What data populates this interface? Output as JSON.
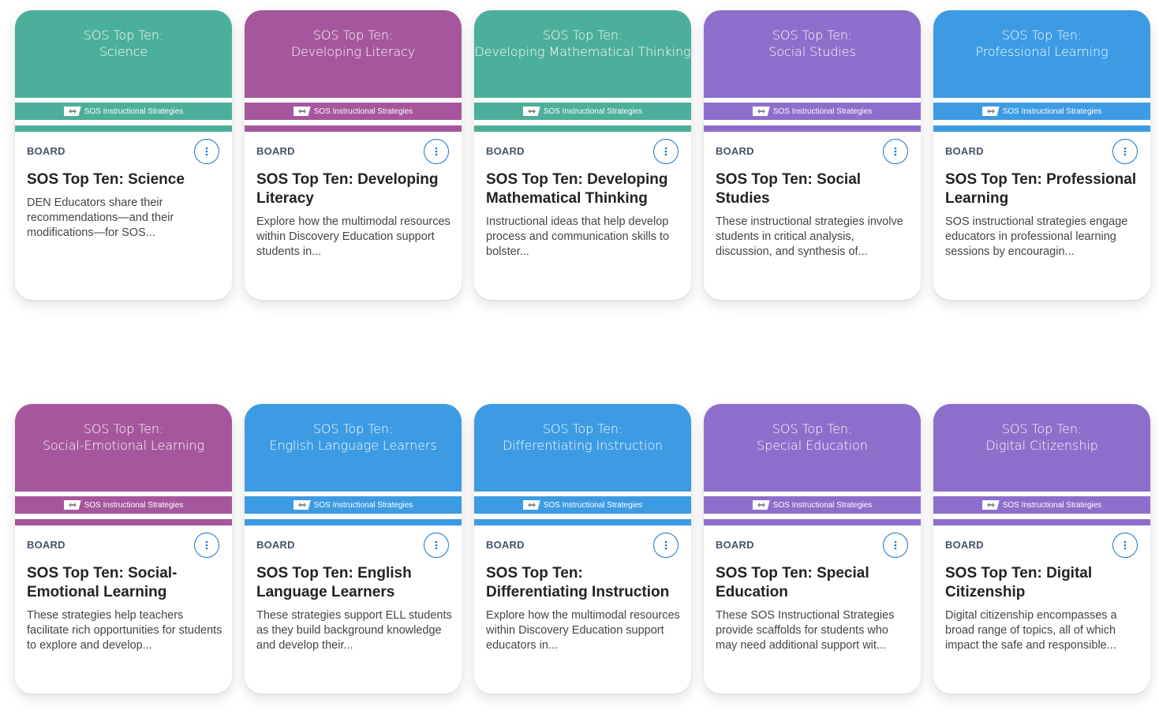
{
  "badge_text": "SOS Instructional Strategies",
  "kind_label": "BOARD",
  "colors": {
    "teal": "#4caf9b",
    "magenta": "#a6569c",
    "purple": "#8e6ecb",
    "blue": "#3d9be3",
    "menu": "#1a73c9"
  },
  "rows": [
    [
      {
        "color": "#4caf9b",
        "thumb_l1": "SOS Top Ten:",
        "thumb_l2": "Science",
        "title": "SOS Top Ten: Science",
        "title_lines": 1,
        "desc": "DEN Educators share their recommendations—and their modifications—for SOS..."
      },
      {
        "color": "#a6569c",
        "thumb_l1": "SOS Top Ten:",
        "thumb_l2": "Developing Literacy",
        "title": "SOS Top Ten: Developing Literacy",
        "title_lines": 2,
        "desc": "Explore how the multimodal resources within Discovery Education support students in..."
      },
      {
        "color": "#4caf9b",
        "thumb_l1": "SOS Top Ten:",
        "thumb_l2": "Developing Mathematical Thinking",
        "title": "SOS Top Ten: Developing Mathematical Thinking",
        "title_lines": 2,
        "desc": "Instructional ideas that help develop process and communication skills to bolster..."
      },
      {
        "color": "#8e6ecb",
        "thumb_l1": "SOS Top Ten:",
        "thumb_l2": "Social Studies",
        "title": "SOS Top Ten: Social Studies",
        "title_lines": 2,
        "desc": "These instructional strategies involve students in critical analysis, discussion, and synthesis of..."
      },
      {
        "color": "#3d9be3",
        "thumb_l1": "SOS Top Ten:",
        "thumb_l2": "Professional Learning",
        "title": "SOS Top Ten: Professional Learning",
        "title_lines": 2,
        "desc": "SOS instructional strategies engage educators in professional learning sessions by encouragin..."
      }
    ],
    [
      {
        "color": "#a6569c",
        "thumb_l1": "SOS Top Ten:",
        "thumb_l2": "Social-Emotional Learning",
        "title": "SOS Top Ten: Social-Emotional Learning",
        "title_lines": 2,
        "desc": "These strategies help teachers facilitate rich opportunities for students to explore and develop..."
      },
      {
        "color": "#3d9be3",
        "thumb_l1": "SOS Top Ten:",
        "thumb_l2": "English Language Learners",
        "title": "SOS Top Ten: English Language Learners",
        "title_lines": 2,
        "desc": "These strategies support ELL students as they build background knowledge and develop their..."
      },
      {
        "color": "#3d9be3",
        "thumb_l1": "SOS Top Ten:",
        "thumb_l2": "Differentiating Instruction",
        "title": "SOS Top Ten: Differentiating Instruction",
        "title_lines": 2,
        "desc": "Explore how the multimodal resources within Discovery Education support educators in..."
      },
      {
        "color": "#8e6ecb",
        "thumb_l1": "SOS Top Ten:",
        "thumb_l2": "Special Education",
        "title": "SOS Top Ten: Special Education",
        "title_lines": 2,
        "desc": "These SOS Instructional Strategies provide scaffolds for students who may need additional support wit..."
      },
      {
        "color": "#8e6ecb",
        "thumb_l1": "SOS Top Ten:",
        "thumb_l2": "Digital Citizenship",
        "title": "SOS Top Ten: Digital Citizenship",
        "title_lines": 2,
        "desc": "Digital citizenship encompasses a broad range of topics, all of which impact the safe and responsible..."
      }
    ]
  ]
}
